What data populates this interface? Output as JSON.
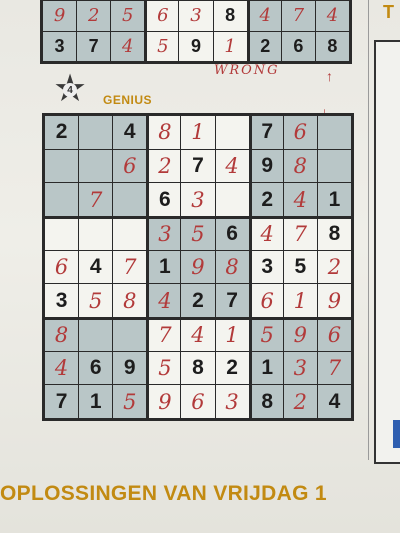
{
  "puzzle": {
    "number": "4",
    "level": "GENIUS",
    "note": "WRONG"
  },
  "top_grid": {
    "rows": [
      [
        {
          "v": "9",
          "pen": true
        },
        {
          "v": "2",
          "pen": true
        },
        {
          "v": "5",
          "pen": true
        },
        {
          "v": "6",
          "pen": true
        },
        {
          "v": "3",
          "pen": true
        },
        {
          "v": "8",
          "pen": false
        },
        {
          "v": "4",
          "pen": true
        },
        {
          "v": "7",
          "pen": true
        },
        {
          "v": "4",
          "pen": true
        }
      ],
      [
        {
          "v": "3",
          "pen": false
        },
        {
          "v": "7",
          "pen": false
        },
        {
          "v": "4",
          "pen": true
        },
        {
          "v": "5",
          "pen": true
        },
        {
          "v": "9",
          "pen": false
        },
        {
          "v": "1",
          "pen": true
        },
        {
          "v": "2",
          "pen": false
        },
        {
          "v": "6",
          "pen": false
        },
        {
          "v": "8",
          "pen": false
        }
      ]
    ]
  },
  "main_grid": {
    "rows": [
      [
        {
          "v": "2",
          "pen": false
        },
        {
          "v": "",
          "pen": false
        },
        {
          "v": "4",
          "pen": false
        },
        {
          "v": "8",
          "pen": true
        },
        {
          "v": "1",
          "pen": true
        },
        {
          "v": "",
          "pen": false
        },
        {
          "v": "7",
          "pen": false
        },
        {
          "v": "6",
          "pen": true
        },
        {
          "v": "",
          "pen": false
        }
      ],
      [
        {
          "v": "",
          "pen": false
        },
        {
          "v": "",
          "pen": false
        },
        {
          "v": "6",
          "pen": true
        },
        {
          "v": "2",
          "pen": true
        },
        {
          "v": "7",
          "pen": false
        },
        {
          "v": "4",
          "pen": true
        },
        {
          "v": "9",
          "pen": false
        },
        {
          "v": "8",
          "pen": true
        },
        {
          "v": "",
          "pen": false
        }
      ],
      [
        {
          "v": "",
          "pen": false
        },
        {
          "v": "7",
          "pen": true
        },
        {
          "v": "",
          "pen": false
        },
        {
          "v": "6",
          "pen": false
        },
        {
          "v": "3",
          "pen": true
        },
        {
          "v": "",
          "pen": false
        },
        {
          "v": "2",
          "pen": false
        },
        {
          "v": "4",
          "pen": true
        },
        {
          "v": "1",
          "pen": false
        }
      ],
      [
        {
          "v": "",
          "pen": false
        },
        {
          "v": "",
          "pen": false
        },
        {
          "v": "",
          "pen": false
        },
        {
          "v": "3",
          "pen": true
        },
        {
          "v": "5",
          "pen": true
        },
        {
          "v": "6",
          "pen": false
        },
        {
          "v": "4",
          "pen": true
        },
        {
          "v": "7",
          "pen": true
        },
        {
          "v": "8",
          "pen": false
        }
      ],
      [
        {
          "v": "6",
          "pen": true
        },
        {
          "v": "4",
          "pen": false
        },
        {
          "v": "7",
          "pen": true
        },
        {
          "v": "1",
          "pen": false
        },
        {
          "v": "9",
          "pen": true
        },
        {
          "v": "8",
          "pen": true
        },
        {
          "v": "3",
          "pen": false
        },
        {
          "v": "5",
          "pen": false
        },
        {
          "v": "2",
          "pen": true
        }
      ],
      [
        {
          "v": "3",
          "pen": false
        },
        {
          "v": "5",
          "pen": true
        },
        {
          "v": "8",
          "pen": true
        },
        {
          "v": "4",
          "pen": true
        },
        {
          "v": "2",
          "pen": false
        },
        {
          "v": "7",
          "pen": false
        },
        {
          "v": "6",
          "pen": true
        },
        {
          "v": "1",
          "pen": true
        },
        {
          "v": "9",
          "pen": true
        }
      ],
      [
        {
          "v": "8",
          "pen": true
        },
        {
          "v": "",
          "pen": false
        },
        {
          "v": "",
          "pen": false
        },
        {
          "v": "7",
          "pen": true
        },
        {
          "v": "4",
          "pen": true
        },
        {
          "v": "1",
          "pen": true
        },
        {
          "v": "5",
          "pen": true
        },
        {
          "v": "9",
          "pen": true
        },
        {
          "v": "6",
          "pen": true
        }
      ],
      [
        {
          "v": "4",
          "pen": true
        },
        {
          "v": "6",
          "pen": false
        },
        {
          "v": "9",
          "pen": false
        },
        {
          "v": "5",
          "pen": true
        },
        {
          "v": "8",
          "pen": false
        },
        {
          "v": "2",
          "pen": false
        },
        {
          "v": "1",
          "pen": false
        },
        {
          "v": "3",
          "pen": true
        },
        {
          "v": "7",
          "pen": true
        }
      ],
      [
        {
          "v": "7",
          "pen": false
        },
        {
          "v": "1",
          "pen": false
        },
        {
          "v": "5",
          "pen": true
        },
        {
          "v": "9",
          "pen": true
        },
        {
          "v": "6",
          "pen": true
        },
        {
          "v": "3",
          "pen": true
        },
        {
          "v": "8",
          "pen": false
        },
        {
          "v": "2",
          "pen": true
        },
        {
          "v": "4",
          "pen": false
        }
      ]
    ]
  },
  "side": {
    "title_letter": "T"
  },
  "footer": {
    "text": "OPLOSSINGEN VAN VRIJDAG 1"
  },
  "colors": {
    "ink": "#1d1d1d",
    "pen": "#b23a3a",
    "shade": "#b9c6c7",
    "accent": "#c28a12"
  }
}
